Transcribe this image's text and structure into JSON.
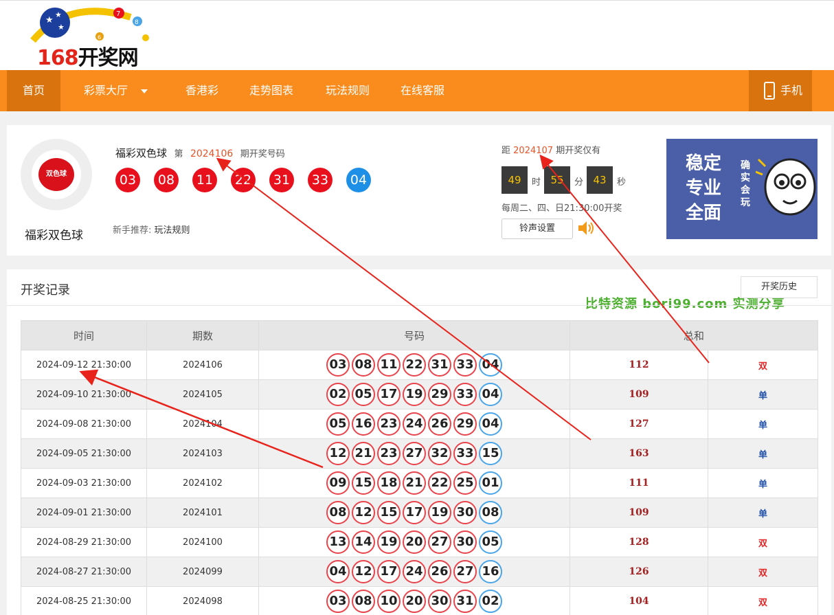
{
  "header": {
    "logo_number": "168",
    "logo_text": "开奖网"
  },
  "nav": {
    "items": [
      "首页",
      "彩票大厅",
      "香港彩",
      "走势图表",
      "玩法规则",
      "在线客服"
    ],
    "mobile": "手机端"
  },
  "draw": {
    "lottery_name": "福彩双色球",
    "badge_text": "双色球",
    "issue_prefix": "第",
    "issue": "2024106",
    "issue_suffix": "期开奖号码",
    "red_balls": [
      "03",
      "08",
      "11",
      "22",
      "31",
      "33"
    ],
    "blue_ball": "04",
    "newbie_label": "新手推荐:",
    "newbie_link": "玩法规则"
  },
  "countdown": {
    "prefix": "距",
    "next_issue": "2024107",
    "suffix": "期开奖仅有",
    "hours": "49",
    "hours_unit": "时",
    "minutes": "55",
    "minutes_unit": "分",
    "seconds": "43",
    "seconds_unit": "秒",
    "schedule": "每周二、四、日21:30:00开奖",
    "sound_button": "铃声设置"
  },
  "ad": {
    "big_text": "稳定专业全面",
    "small_text": "确实会玩"
  },
  "records": {
    "title": "开奖记录",
    "history_button": "开奖历史",
    "watermark": "比特资源 bori99.com 实测分享",
    "columns": [
      "时间",
      "期数",
      "号码",
      "总和"
    ],
    "rows": [
      {
        "time": "2024-09-12 21:30:00",
        "issue": "2024106",
        "reds": [
          "03",
          "08",
          "11",
          "22",
          "31",
          "33"
        ],
        "blue": "04",
        "sum": "112",
        "parity": "双"
      },
      {
        "time": "2024-09-10 21:30:00",
        "issue": "2024105",
        "reds": [
          "02",
          "05",
          "17",
          "19",
          "29",
          "33"
        ],
        "blue": "04",
        "sum": "109",
        "parity": "单"
      },
      {
        "time": "2024-09-08 21:30:00",
        "issue": "2024104",
        "reds": [
          "05",
          "16",
          "23",
          "24",
          "26",
          "29"
        ],
        "blue": "04",
        "sum": "127",
        "parity": "单"
      },
      {
        "time": "2024-09-05 21:30:00",
        "issue": "2024103",
        "reds": [
          "12",
          "21",
          "23",
          "27",
          "32",
          "33"
        ],
        "blue": "15",
        "sum": "163",
        "parity": "单"
      },
      {
        "time": "2024-09-03 21:30:00",
        "issue": "2024102",
        "reds": [
          "09",
          "15",
          "18",
          "21",
          "22",
          "25"
        ],
        "blue": "01",
        "sum": "111",
        "parity": "单"
      },
      {
        "time": "2024-09-01 21:30:00",
        "issue": "2024101",
        "reds": [
          "08",
          "12",
          "15",
          "17",
          "19",
          "30"
        ],
        "blue": "08",
        "sum": "109",
        "parity": "单"
      },
      {
        "time": "2024-08-29 21:30:00",
        "issue": "2024100",
        "reds": [
          "13",
          "14",
          "19",
          "20",
          "27",
          "30"
        ],
        "blue": "05",
        "sum": "128",
        "parity": "双"
      },
      {
        "time": "2024-08-27 21:30:00",
        "issue": "2024099",
        "reds": [
          "04",
          "12",
          "17",
          "24",
          "26",
          "27"
        ],
        "blue": "16",
        "sum": "126",
        "parity": "双"
      },
      {
        "time": "2024-08-25 21:30:00",
        "issue": "2024098",
        "reds": [
          "03",
          "08",
          "10",
          "20",
          "30",
          "31"
        ],
        "blue": "02",
        "sum": "104",
        "parity": "双"
      }
    ]
  },
  "colors": {
    "nav_orange": "#fa8c1d",
    "nav_active": "#d9730e",
    "red_ball": "#e8101c",
    "blue_ball": "#1e8fe6",
    "annotation_arrow": "#e8231b"
  }
}
